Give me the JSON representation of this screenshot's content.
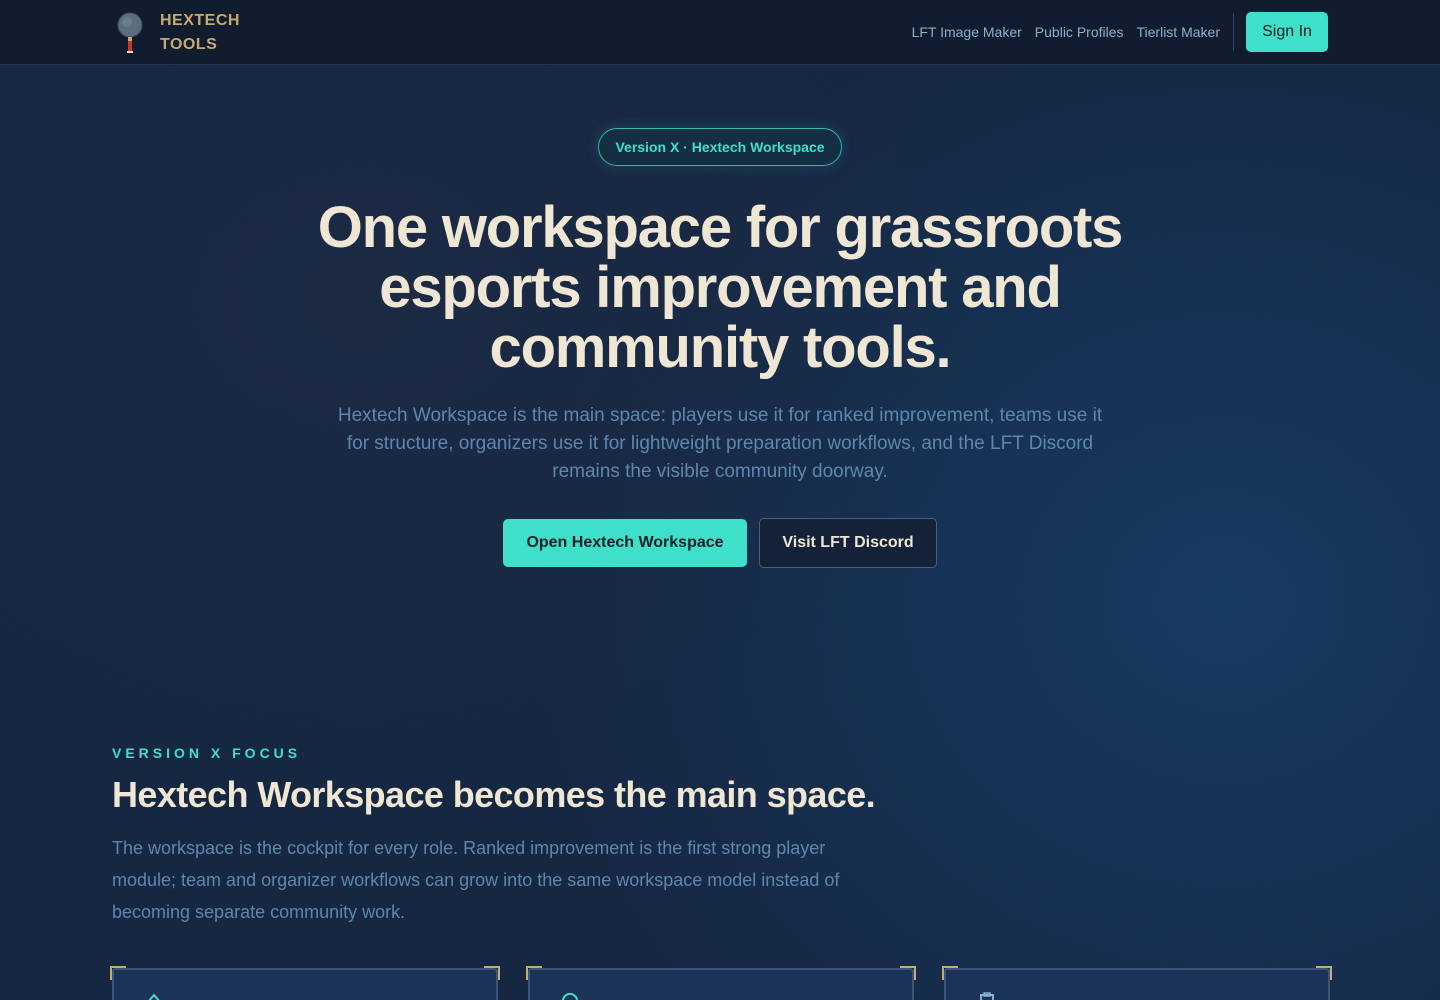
{
  "header": {
    "brand_line1": "HEXTECH",
    "brand_line2": "TOOLS",
    "brand_logo_icon": "hextech-lantern-icon",
    "nav": [
      {
        "label": "LFT Image Maker"
      },
      {
        "label": "Public Profiles"
      },
      {
        "label": "Tierlist Maker"
      }
    ],
    "sign_in_label": "Sign In"
  },
  "hero": {
    "badge": "Version X · Hextech Workspace",
    "title": "One workspace for grassroots esports improvement and community tools.",
    "subtitle": "Hextech Workspace is the main space: players use it for ranked improvement, teams use it for structure, organizers use it for lightweight preparation workflows, and the LFT Discord remains the visible community doorway.",
    "primary_cta": "Open Hextech Workspace",
    "secondary_cta": "Visit LFT Discord"
  },
  "focus": {
    "eyebrow": "VERSION X FOCUS",
    "title": "Hextech Workspace becomes the main space.",
    "body": "The workspace is the cockpit for every role. Ranked improvement is the first strong player module; team and organizer workflows can grow into the same workspace model instead of becoming separate community work.",
    "cards": [
      {
        "icon": "arrow-up-icon"
      },
      {
        "icon": "refresh-icon"
      },
      {
        "icon": "briefcase-icon"
      }
    ]
  },
  "colors": {
    "accent": "#3fe0c9",
    "gold": "#c8aa6e",
    "heading": "#efe6d3",
    "muted": "#5d87ad",
    "header_bg": "#111d2e"
  }
}
